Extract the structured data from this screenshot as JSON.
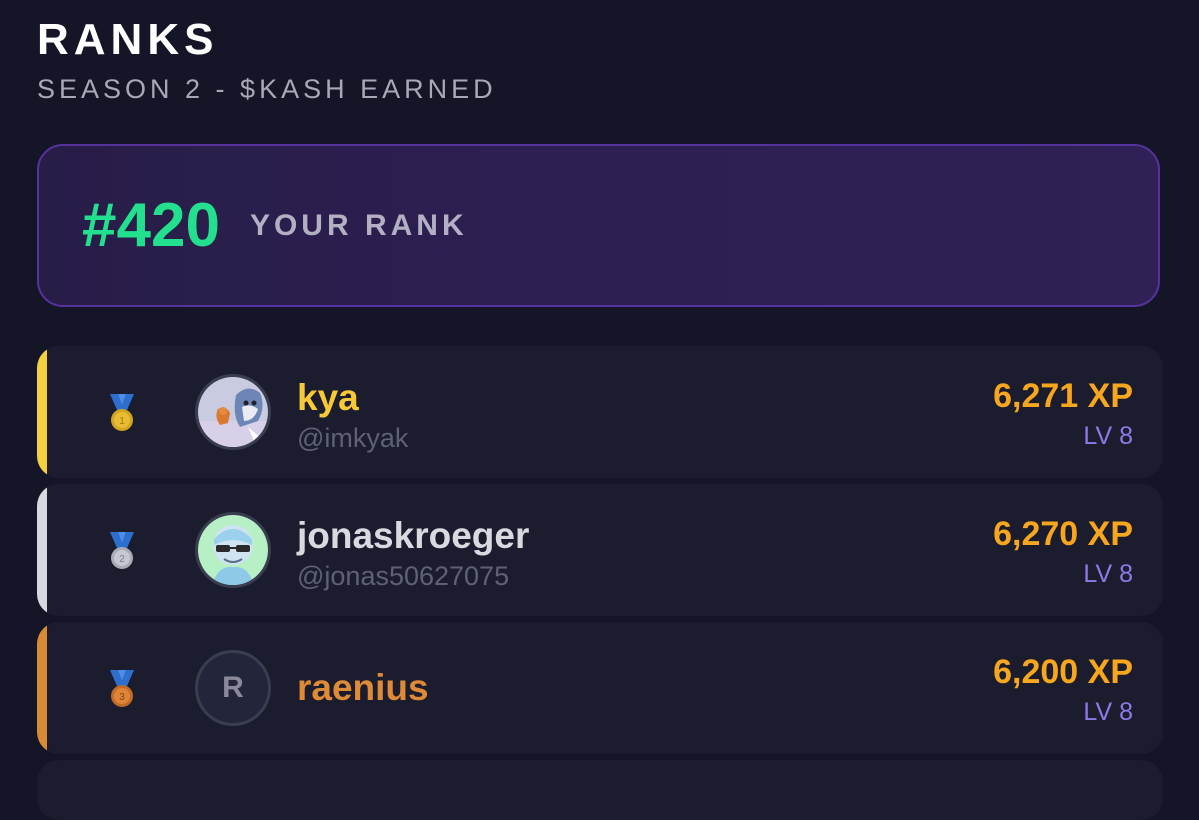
{
  "header": {
    "title": "RANKS",
    "subtitle": "SEASON 2 - $KASH EARNED"
  },
  "your_rank": {
    "rank": "#420",
    "label": "YOUR RANK"
  },
  "leaderboard": [
    {
      "position": 1,
      "medal": "gold-medal-icon",
      "name": "kya",
      "handle": "@imkyak",
      "xp": "6,271 XP",
      "level": "LV 8",
      "accent_color": "#f4d03f",
      "name_color": "#f8c937"
    },
    {
      "position": 2,
      "medal": "silver-medal-icon",
      "name": "jonaskroeger",
      "handle": "@jonas50627075",
      "xp": "6,270 XP",
      "level": "LV 8",
      "accent_color": "#d8d8df",
      "name_color": "#d9d9e0"
    },
    {
      "position": 3,
      "medal": "bronze-medal-icon",
      "name": "raenius",
      "handle": "",
      "avatar_letter": "R",
      "xp": "6,200 XP",
      "level": "LV 8",
      "accent_color": "#d98a35",
      "name_color": "#df8a36"
    }
  ],
  "colors": {
    "background": "#141627",
    "rank_green": "#22e08e",
    "xp_orange": "#f7a61e",
    "level_purple": "#8f79e8",
    "rank_card_border": "#56339c"
  }
}
